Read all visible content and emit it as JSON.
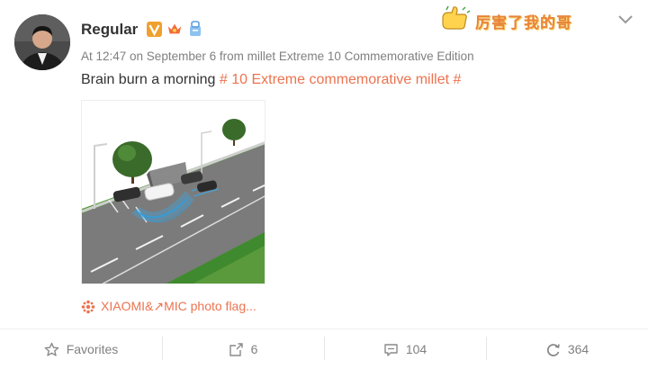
{
  "post": {
    "username": "Regular",
    "meta": "At 12:47 on September 6 from millet Extreme 10 Commemorative Edition",
    "text_prefix": "Brain burn a morning ",
    "hashtag": "# 10 Extreme commemorative millet #"
  },
  "sticker": {
    "text": "厉害了我的哥"
  },
  "photo_source": {
    "label": "XIAOMI&↗MIC photo flag..."
  },
  "actions": {
    "favorites_label": "Favorites",
    "share_count": "6",
    "comment_count": "104",
    "like_count": "364"
  },
  "icons": {
    "verified": "verified-v-icon",
    "vip": "vip-crown-icon",
    "member": "member-badge-icon",
    "star": "star-icon",
    "share": "share-icon",
    "comment": "comment-icon",
    "like": "like-icon",
    "camera": "camera-icon",
    "chevron": "chevron-down-icon"
  },
  "colors": {
    "accent": "#eb7350",
    "verified": "#f0a02c",
    "text": "#333333",
    "muted": "#808080"
  }
}
